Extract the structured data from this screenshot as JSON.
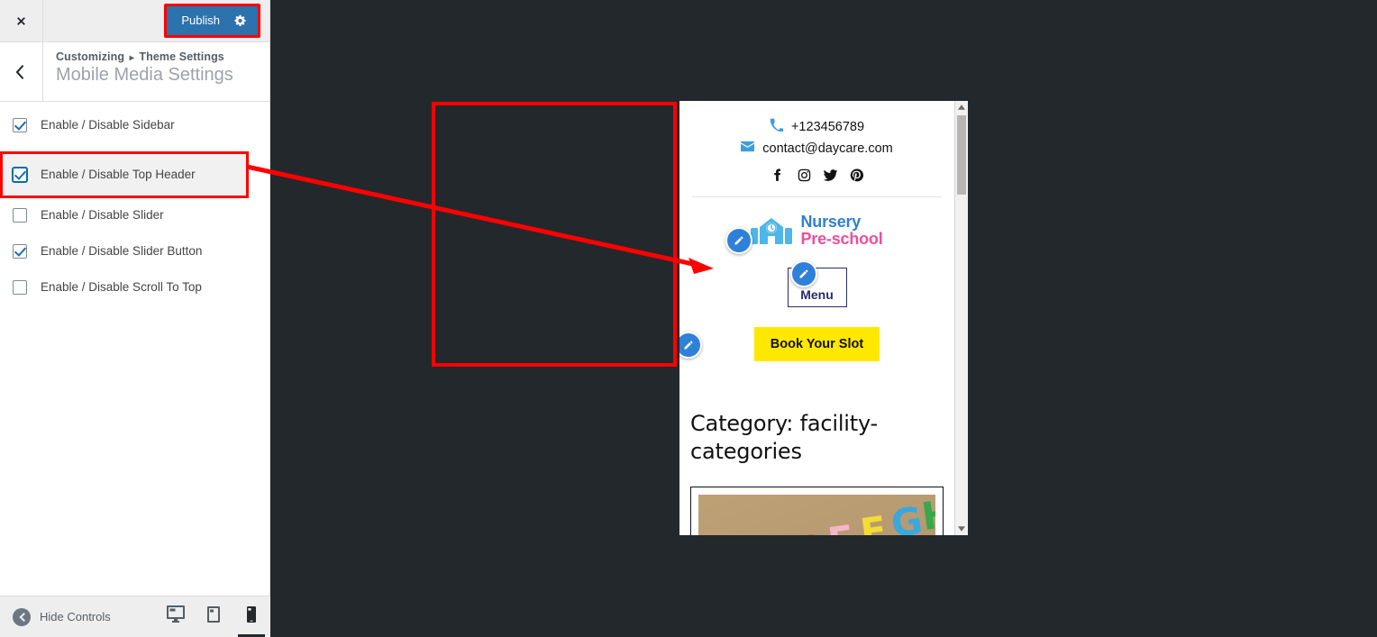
{
  "customizer": {
    "topbar": {
      "close_icon": "close-icon",
      "publish_label": "Publish",
      "publish_settings_icon": "gear-icon"
    },
    "header": {
      "back_icon": "chevron-left-icon",
      "breadcrumb_parent": "Customizing",
      "breadcrumb_separator": "▸",
      "breadcrumb_section": "Theme Settings",
      "panel_title": "Mobile Media Settings"
    },
    "controls": [
      {
        "label": "Enable / Disable Sidebar",
        "checked": true,
        "focused": false,
        "highlighted": false
      },
      {
        "label": "Enable / Disable Top Header",
        "checked": true,
        "focused": true,
        "highlighted": true
      },
      {
        "label": "Enable / Disable Slider",
        "checked": false,
        "focused": false,
        "highlighted": false
      },
      {
        "label": "Enable / Disable Slider Button",
        "checked": true,
        "focused": false,
        "highlighted": false
      },
      {
        "label": "Enable / Disable Scroll To Top",
        "checked": false,
        "focused": false,
        "highlighted": false
      }
    ],
    "footer": {
      "hide_controls_label": "Hide Controls",
      "hide_controls_icon": "collapse-left-icon",
      "devices": [
        {
          "name": "desktop",
          "icon": "desktop-icon",
          "active": false
        },
        {
          "name": "tablet",
          "icon": "tablet-icon",
          "active": false
        },
        {
          "name": "mobile",
          "icon": "mobile-icon",
          "active": true
        }
      ]
    }
  },
  "preview": {
    "site": {
      "top_header": {
        "phone_icon": "phone-icon",
        "phone": "+123456789",
        "email_icon": "envelope-icon",
        "email": "contact@daycare.com",
        "social": [
          {
            "name": "facebook-icon"
          },
          {
            "name": "instagram-icon"
          },
          {
            "name": "twitter-icon"
          },
          {
            "name": "pinterest-icon"
          }
        ]
      },
      "logo": {
        "icon": "school-building-icon",
        "line1": "Nursery",
        "line2": "Pre-school",
        "line1_color": "#2f7fd4",
        "line2_color": "#ec4f9b"
      },
      "menu_label": "Menu",
      "cta_label": "Book Your Slot",
      "cta_color": "#ffe800",
      "category_title": "Category: facility-categories",
      "post_thumb_alt": "colorful alphabet letters"
    },
    "scrollbar": {
      "up_icon": "scroll-up-icon",
      "down_icon": "scroll-down-icon"
    },
    "edit_shortcuts": [
      {
        "name": "edit-shortcut-logo"
      },
      {
        "name": "edit-shortcut-menu"
      },
      {
        "name": "edit-shortcut-sidebar"
      }
    ]
  },
  "annotation": {
    "box_color": "#ff0000",
    "arrow_color": "#ff0000",
    "arrow_from": "Enable / Disable Top Header",
    "arrow_to": "site top header region"
  }
}
